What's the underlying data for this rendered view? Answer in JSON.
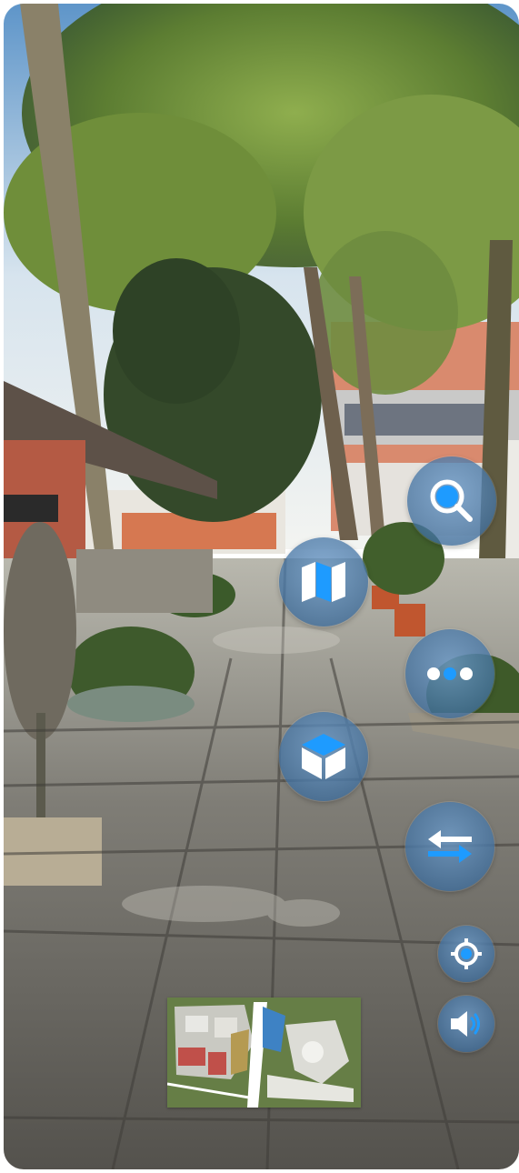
{
  "viewer": {
    "scene": "street-view-panorama",
    "accent_color": "#1e9bff",
    "button_color": "#3d6f9f"
  },
  "controls": [
    {
      "id": "search",
      "icon": "search-icon"
    },
    {
      "id": "map",
      "icon": "map-icon"
    },
    {
      "id": "more",
      "icon": "more-dots-icon"
    },
    {
      "id": "3d",
      "icon": "cube-icon"
    },
    {
      "id": "switch",
      "icon": "swap-arrows-icon"
    },
    {
      "id": "locate",
      "icon": "crosshair-icon"
    },
    {
      "id": "sound",
      "icon": "speaker-icon"
    }
  ],
  "minimap": {
    "visible": true,
    "background_color": "#667e46"
  }
}
